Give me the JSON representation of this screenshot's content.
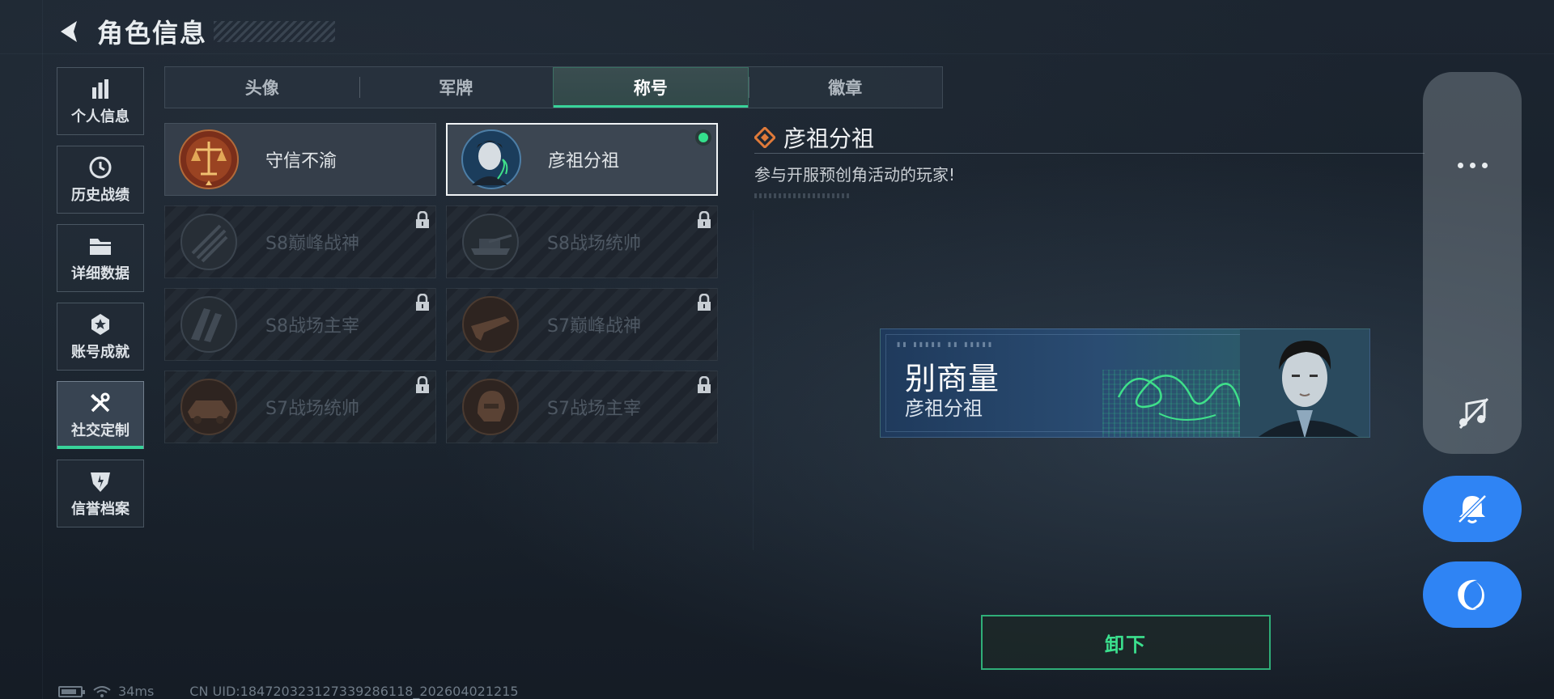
{
  "header": {
    "title": "角色信息"
  },
  "sidebar": {
    "items": [
      {
        "label": "个人信息"
      },
      {
        "label": "历史战绩"
      },
      {
        "label": "详细数据"
      },
      {
        "label": "账号成就"
      },
      {
        "label": "社交定制",
        "active": true
      },
      {
        "label": "信誉档案"
      }
    ]
  },
  "tabs": [
    {
      "label": "头像"
    },
    {
      "label": "军牌"
    },
    {
      "label": "称号",
      "active": true
    },
    {
      "label": "徽章"
    }
  ],
  "titles": [
    {
      "name": "守信不渝",
      "locked": false,
      "icon": "scales-icon"
    },
    {
      "name": "彦祖分祖",
      "locked": false,
      "selected": true,
      "equipped": true,
      "icon": "portrait-icon"
    },
    {
      "name": "S8巅峰战神",
      "locked": true,
      "icon": "rifle-emblem-icon"
    },
    {
      "name": "S8战场统帅",
      "locked": true,
      "icon": "tank-emblem-icon"
    },
    {
      "name": "S8战场主宰",
      "locked": true,
      "icon": "building-emblem-icon"
    },
    {
      "name": "S7巅峰战神",
      "locked": true,
      "icon": "gun-emblem-icon"
    },
    {
      "name": "S7战场统帅",
      "locked": true,
      "icon": "vehicle-emblem-icon"
    },
    {
      "name": "S7战场主宰",
      "locked": true,
      "icon": "helmet-emblem-icon"
    }
  ],
  "detail": {
    "name": "彦祖分祖",
    "description": "参与开服预创角活动的玩家!"
  },
  "preview": {
    "nickname": "别商量",
    "title": "彦祖分祖"
  },
  "actions": {
    "unequip_label": "卸下"
  },
  "status": {
    "ping": "34ms",
    "uid": "CN UID:184720323127339286118_202604021215"
  },
  "colors": {
    "accent_green": "#38d39a",
    "button_blue": "#2f84f4",
    "equipped_dot": "#34e08c"
  }
}
